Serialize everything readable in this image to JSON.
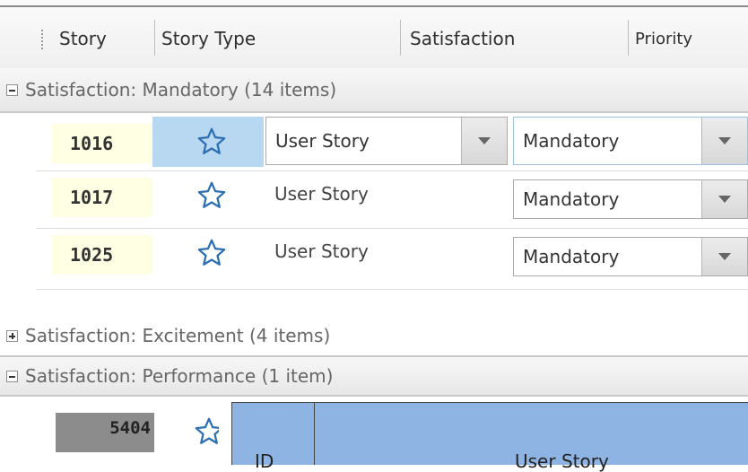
{
  "header": {
    "columns": [
      "Story",
      "Story Type",
      "Satisfaction",
      "Priority"
    ]
  },
  "groups": [
    {
      "label": "Satisfaction: Mandatory (14 items)",
      "expanded": true
    },
    {
      "label": "Satisfaction: Excitement (4 items)",
      "expanded": false
    },
    {
      "label": "Satisfaction: Performance (1 item)",
      "expanded": true
    }
  ],
  "rows": [
    {
      "id": "1016",
      "story_type": "User Story",
      "satisfaction": "Mandatory",
      "selected": true
    },
    {
      "id": "1017",
      "story_type": "User Story",
      "satisfaction": "Mandatory"
    },
    {
      "id": "1025",
      "story_type": "User Story",
      "satisfaction": "Mandatory"
    }
  ],
  "performance_row": {
    "id": "5404"
  },
  "inset_table": {
    "col_id": "ID",
    "col_story": "User Story"
  },
  "icons": {
    "favorite": "star-outline-icon",
    "dropdown": "chevron-down-icon",
    "collapse": "minus-box-icon",
    "expand": "plus-box-icon"
  },
  "colors": {
    "id_bg": "#ffffe3",
    "selection": "#b8d7f1",
    "star": "#2c6fb3",
    "inset_header": "#8eb4e3"
  }
}
